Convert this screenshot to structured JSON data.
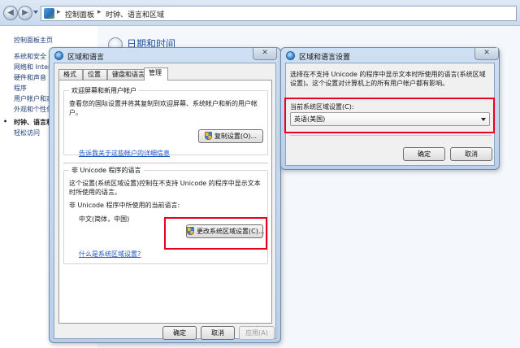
{
  "explorer": {
    "address": {
      "separator": "▸",
      "segments": [
        "控制面板",
        "时钟、语言和区域"
      ]
    },
    "sidebar": {
      "home": "控制面板主页",
      "items": [
        "系统和安全",
        "网络和 Intern",
        "硬件和声音",
        "程序",
        "用户帐户和家",
        "外观和个性化",
        "时钟、语言和",
        "轻松访问"
      ]
    },
    "main": {
      "title": "日期和时间"
    }
  },
  "region_window": {
    "title": "区域和语言",
    "close": "✕",
    "tabs": [
      "格式",
      "位置",
      "键盘和语言",
      "管理"
    ],
    "active_tab": "管理",
    "welcome_group": {
      "title": "欢迎屏幕和新用户帐户",
      "description": "查看您的国际设置并将其复制到欢迎屏幕、系统帐户和新的用户帐户。",
      "copy_button": "复制设置(O)...",
      "link": "告诉我关于这些帐户的详细信息"
    },
    "unicode_group": {
      "title": "非 Unicode 程序的语言",
      "description": "这个设置(系统区域设置)控制在不支持 Unicode 的程序中显示文本时所使用的语言。",
      "current_label": "非 Unicode 程序中所使用的当前语言:",
      "current_value": "中文(简体，中国)",
      "change_button": "更改系统区域设置(C)...",
      "link": "什么是系统区域设置?"
    },
    "footer": {
      "ok": "确定",
      "cancel": "取消",
      "apply": "应用(A)"
    }
  },
  "settings_window": {
    "title": "区域和语言设置",
    "close": "✕",
    "description": "选择在不支持 Unicode 的程序中显示文本时所使用的语言(系统区域设置)。这个设置对计算机上的所有用户帐户都有影响。",
    "locale_label": "当前系统区域设置(C):",
    "locale_value": "英语(美国)",
    "ok": "确定",
    "cancel": "取消"
  },
  "colors": {
    "highlight": "#e8001c",
    "link": "#1d56c5",
    "title_blue": "#1e4f9e"
  }
}
